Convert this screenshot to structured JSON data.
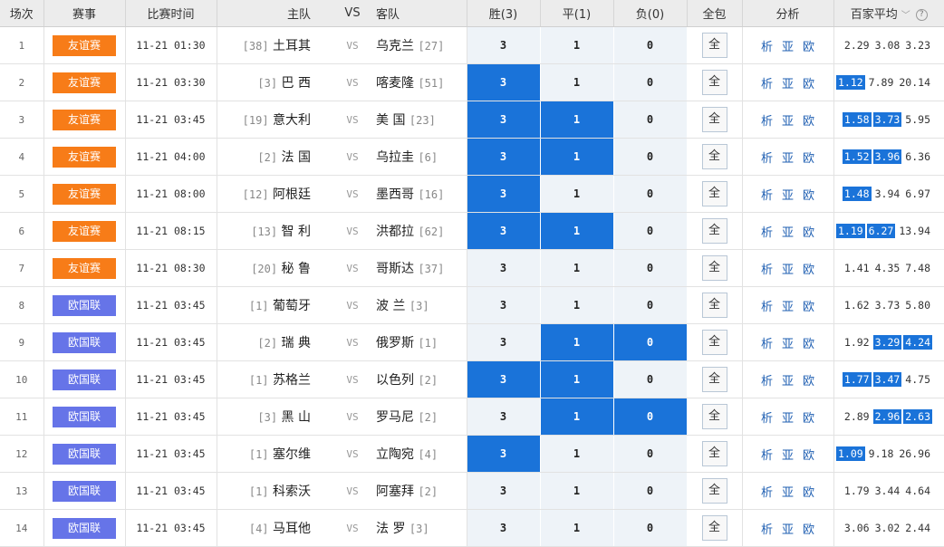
{
  "colors": {
    "friendly": "#f77c18",
    "nations_league": "#6674e8",
    "selected": "#1a73d9"
  },
  "header": {
    "index": "场次",
    "league": "赛事",
    "time": "比赛时间",
    "home": "主队",
    "vs": "VS",
    "away": "客队",
    "win": "胜(3)",
    "draw": "平(1)",
    "loss": "负(0)",
    "all": "全包",
    "analysis": "分析",
    "avg": "百家平均"
  },
  "links": {
    "xi": "析",
    "ya": "亚",
    "ou": "欧"
  },
  "all_label": "全",
  "rows": [
    {
      "idx": "1",
      "league": "友谊赛",
      "lt": "friendly",
      "time": "11-21 01:30",
      "home_rank": "[38]",
      "home": "土耳其",
      "vs": "VS",
      "away": "乌克兰",
      "away_rank": "[27]",
      "w": "3",
      "d": "1",
      "l": "0",
      "sel": [
        false,
        false,
        false
      ],
      "o1": "2.29",
      "o2": "3.08",
      "o3": "3.23",
      "hl": [
        false,
        false,
        false
      ]
    },
    {
      "idx": "2",
      "league": "友谊赛",
      "lt": "friendly",
      "time": "11-21 03:30",
      "home_rank": "[3]",
      "home": "巴 西",
      "vs": "VS",
      "away": "喀麦隆",
      "away_rank": "[51]",
      "w": "3",
      "d": "1",
      "l": "0",
      "sel": [
        true,
        false,
        false
      ],
      "o1": "1.12",
      "o2": "7.89",
      "o3": "20.14",
      "hl": [
        true,
        false,
        false
      ]
    },
    {
      "idx": "3",
      "league": "友谊赛",
      "lt": "friendly",
      "time": "11-21 03:45",
      "home_rank": "[19]",
      "home": "意大利",
      "vs": "VS",
      "away": "美 国",
      "away_rank": "[23]",
      "w": "3",
      "d": "1",
      "l": "0",
      "sel": [
        true,
        true,
        false
      ],
      "o1": "1.58",
      "o2": "3.73",
      "o3": "5.95",
      "hl": [
        true,
        true,
        false
      ]
    },
    {
      "idx": "4",
      "league": "友谊赛",
      "lt": "friendly",
      "time": "11-21 04:00",
      "home_rank": "[2]",
      "home": "法 国",
      "vs": "VS",
      "away": "乌拉圭",
      "away_rank": "[6]",
      "w": "3",
      "d": "1",
      "l": "0",
      "sel": [
        true,
        true,
        false
      ],
      "o1": "1.52",
      "o2": "3.96",
      "o3": "6.36",
      "hl": [
        true,
        true,
        false
      ]
    },
    {
      "idx": "5",
      "league": "友谊赛",
      "lt": "friendly",
      "time": "11-21 08:00",
      "home_rank": "[12]",
      "home": "阿根廷",
      "vs": "VS",
      "away": "墨西哥",
      "away_rank": "[16]",
      "w": "3",
      "d": "1",
      "l": "0",
      "sel": [
        true,
        false,
        false
      ],
      "o1": "1.48",
      "o2": "3.94",
      "o3": "6.97",
      "hl": [
        true,
        false,
        false
      ]
    },
    {
      "idx": "6",
      "league": "友谊赛",
      "lt": "friendly",
      "time": "11-21 08:15",
      "home_rank": "[13]",
      "home": "智 利",
      "vs": "VS",
      "away": "洪都拉",
      "away_rank": "[62]",
      "w": "3",
      "d": "1",
      "l": "0",
      "sel": [
        true,
        true,
        false
      ],
      "o1": "1.19",
      "o2": "6.27",
      "o3": "13.94",
      "hl": [
        true,
        true,
        false
      ]
    },
    {
      "idx": "7",
      "league": "友谊赛",
      "lt": "friendly",
      "time": "11-21 08:30",
      "home_rank": "[20]",
      "home": "秘 鲁",
      "vs": "VS",
      "away": "哥斯达",
      "away_rank": "[37]",
      "w": "3",
      "d": "1",
      "l": "0",
      "sel": [
        false,
        false,
        false
      ],
      "o1": "1.41",
      "o2": "4.35",
      "o3": "7.48",
      "hl": [
        false,
        false,
        false
      ]
    },
    {
      "idx": "8",
      "league": "欧国联",
      "lt": "nations_league",
      "time": "11-21 03:45",
      "home_rank": "[1]",
      "home": "葡萄牙",
      "vs": "VS",
      "away": "波 兰",
      "away_rank": "[3]",
      "w": "3",
      "d": "1",
      "l": "0",
      "sel": [
        false,
        false,
        false
      ],
      "o1": "1.62",
      "o2": "3.73",
      "o3": "5.80",
      "hl": [
        false,
        false,
        false
      ]
    },
    {
      "idx": "9",
      "league": "欧国联",
      "lt": "nations_league",
      "time": "11-21 03:45",
      "home_rank": "[2]",
      "home": "瑞 典",
      "vs": "VS",
      "away": "俄罗斯",
      "away_rank": "[1]",
      "w": "3",
      "d": "1",
      "l": "0",
      "sel": [
        false,
        true,
        true
      ],
      "o1": "1.92",
      "o2": "3.29",
      "o3": "4.24",
      "hl": [
        false,
        true,
        true
      ]
    },
    {
      "idx": "10",
      "league": "欧国联",
      "lt": "nations_league",
      "time": "11-21 03:45",
      "home_rank": "[1]",
      "home": "苏格兰",
      "vs": "VS",
      "away": "以色列",
      "away_rank": "[2]",
      "w": "3",
      "d": "1",
      "l": "0",
      "sel": [
        true,
        true,
        false
      ],
      "o1": "1.77",
      "o2": "3.47",
      "o3": "4.75",
      "hl": [
        true,
        true,
        false
      ]
    },
    {
      "idx": "11",
      "league": "欧国联",
      "lt": "nations_league",
      "time": "11-21 03:45",
      "home_rank": "[3]",
      "home": "黑 山",
      "vs": "VS",
      "away": "罗马尼",
      "away_rank": "[2]",
      "w": "3",
      "d": "1",
      "l": "0",
      "sel": [
        false,
        true,
        true
      ],
      "o1": "2.89",
      "o2": "2.96",
      "o3": "2.63",
      "hl": [
        false,
        true,
        true
      ]
    },
    {
      "idx": "12",
      "league": "欧国联",
      "lt": "nations_league",
      "time": "11-21 03:45",
      "home_rank": "[1]",
      "home": "塞尔维",
      "vs": "VS",
      "away": "立陶宛",
      "away_rank": "[4]",
      "w": "3",
      "d": "1",
      "l": "0",
      "sel": [
        true,
        false,
        false
      ],
      "o1": "1.09",
      "o2": "9.18",
      "o3": "26.96",
      "hl": [
        true,
        false,
        false
      ]
    },
    {
      "idx": "13",
      "league": "欧国联",
      "lt": "nations_league",
      "time": "11-21 03:45",
      "home_rank": "[1]",
      "home": "科索沃",
      "vs": "VS",
      "away": "阿塞拜",
      "away_rank": "[2]",
      "w": "3",
      "d": "1",
      "l": "0",
      "sel": [
        false,
        false,
        false
      ],
      "o1": "1.79",
      "o2": "3.44",
      "o3": "4.64",
      "hl": [
        false,
        false,
        false
      ]
    },
    {
      "idx": "14",
      "league": "欧国联",
      "lt": "nations_league",
      "time": "11-21 03:45",
      "home_rank": "[4]",
      "home": "马耳他",
      "vs": "VS",
      "away": "法 罗",
      "away_rank": "[3]",
      "w": "3",
      "d": "1",
      "l": "0",
      "sel": [
        false,
        false,
        false
      ],
      "o1": "3.06",
      "o2": "3.02",
      "o3": "2.44",
      "hl": [
        false,
        false,
        false
      ]
    }
  ]
}
